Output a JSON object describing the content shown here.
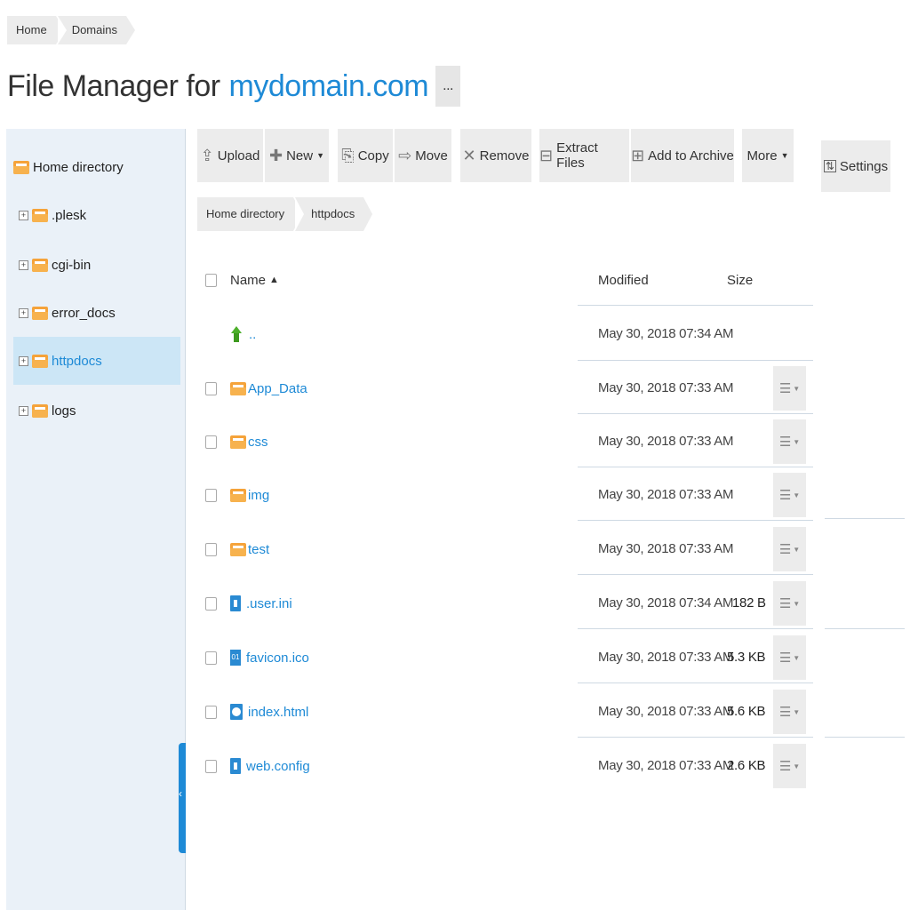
{
  "breadcrumb": [
    "Home",
    "Domains"
  ],
  "title": {
    "prefix": "File Manager for",
    "domain": "mydomain.com",
    "more": "..."
  },
  "sidebar": {
    "items": [
      {
        "label": "Home directory",
        "expandable": false,
        "active": false
      },
      {
        "label": ".plesk",
        "expandable": true,
        "active": false
      },
      {
        "label": "cgi-bin",
        "expandable": true,
        "active": false
      },
      {
        "label": "error_docs",
        "expandable": true,
        "active": false
      },
      {
        "label": "httpdocs",
        "expandable": true,
        "active": true
      },
      {
        "label": "logs",
        "expandable": true,
        "active": false
      }
    ]
  },
  "toolbar": {
    "upload": "Upload",
    "new": "New",
    "copy": "Copy",
    "move": "Move",
    "remove": "Remove",
    "extract": "Extract Files",
    "archive": "Add to Archive",
    "more": "More",
    "settings": "Settings"
  },
  "path": [
    "Home directory",
    "httpdocs"
  ],
  "table": {
    "headers": {
      "name": "Name",
      "modified": "Modified",
      "size": "Size"
    },
    "rows": [
      {
        "name": "..",
        "type": "up",
        "modified": "May 30, 2018 07:34 AM",
        "size": ""
      },
      {
        "name": "App_Data",
        "type": "folder",
        "modified": "May 30, 2018 07:33 AM",
        "size": ""
      },
      {
        "name": "css",
        "type": "folder",
        "modified": "May 30, 2018 07:33 AM",
        "size": ""
      },
      {
        "name": "img",
        "type": "folder",
        "modified": "May 30, 2018 07:33 AM",
        "size": ""
      },
      {
        "name": "test",
        "type": "folder",
        "modified": "May 30, 2018 07:33 AM",
        "size": ""
      },
      {
        "name": ".user.ini",
        "type": "file",
        "modified": "May 30, 2018 07:34 AM",
        "size": "182 B"
      },
      {
        "name": "favicon.ico",
        "type": "binary",
        "modified": "May 30, 2018 07:33 AM",
        "size": "5.3 KB"
      },
      {
        "name": "index.html",
        "type": "web",
        "modified": "May 30, 2018 07:33 AM",
        "size": "5.6 KB"
      },
      {
        "name": "web.config",
        "type": "file",
        "modified": "May 30, 2018 07:33 AM",
        "size": "2.6 KB"
      }
    ]
  }
}
